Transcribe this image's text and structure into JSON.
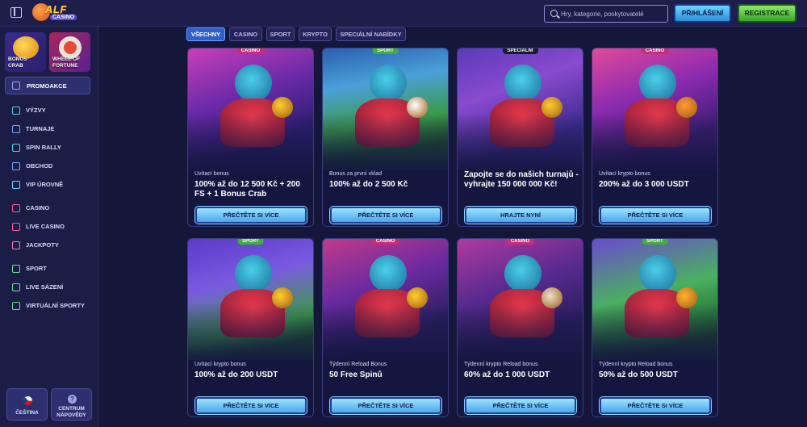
{
  "header": {
    "logo_main": "ALF",
    "logo_sub": "CASINO",
    "search_placeholder": "Hry, kategorie, poskytovatelé",
    "login_label": "PŘIHLÁŠENÍ",
    "register_label": "REGISTRACE"
  },
  "sidebar": {
    "promo_tiles": [
      {
        "label_line1": "BONUS",
        "label_line2": "CRAB"
      },
      {
        "label_line1": "WHEEL OF",
        "label_line2": "FORTUNE"
      }
    ],
    "promotions_label": "PROMOAKCE",
    "items": [
      {
        "label": "VÝZVY",
        "icon": "target-icon",
        "color": "#58d0e6"
      },
      {
        "label": "TURNAJE",
        "icon": "trophy-icon",
        "color": "#7aa8ff"
      },
      {
        "label": "SPIN RALLY",
        "icon": "rally-icon",
        "color": "#58d0e6"
      },
      {
        "label": "OBCHOD",
        "icon": "shop-icon",
        "color": "#7aa8ff"
      },
      {
        "label": "VIP ÚROVNĚ",
        "icon": "diamond-icon",
        "color": "#6ad7ff"
      },
      {
        "label": "CASINO",
        "icon": "cherry-icon",
        "color": "#ff5a9a"
      },
      {
        "label": "LIVE CASINO",
        "icon": "dealer-icon",
        "color": "#ff5a9a"
      },
      {
        "label": "JACKPOTY",
        "icon": "clover-icon",
        "color": "#ff7ab8"
      },
      {
        "label": "SPORT",
        "icon": "ball-icon",
        "color": "#6ae08a"
      },
      {
        "label": "LIVE SÁZENÍ",
        "icon": "live-icon",
        "color": "#6ae08a"
      },
      {
        "label": "VIRTUÁLNÍ SPORTY",
        "icon": "gamepad-icon",
        "color": "#6ae08a"
      }
    ],
    "language_label_1": "ČEŠTINA",
    "help_label_1": "CENTRUM",
    "help_label_2": "NÁPOVĚDY",
    "help_icon_glyph": "?"
  },
  "filters": [
    {
      "label": "VŠECHNY",
      "active": true
    },
    {
      "label": "CASINO",
      "active": false
    },
    {
      "label": "SPORT",
      "active": false
    },
    {
      "label": "KRYPTO",
      "active": false
    },
    {
      "label": "SPECIÁLNÍ NABÍDKY",
      "active": false
    }
  ],
  "cards": [
    {
      "badge": "CASINO",
      "badge_type": "casino",
      "subtitle": "Uvítací bonus",
      "title": "100% až do 12 500 Kč + 200 FS + 1 Bonus Crab",
      "cta": "PŘEČTĚTE SI VÍCE"
    },
    {
      "badge": "SPORT",
      "badge_type": "sport",
      "subtitle": "Bonus za první vklad",
      "title": "100% až do 2 500 Kč",
      "cta": "PŘEČTĚTE SI VÍCE"
    },
    {
      "badge": "SPECIÁLNÍ",
      "badge_type": "special",
      "subtitle": "",
      "title": "Zapojte se do našich turnajů - vyhrajte 150 000 000 Kč!",
      "cta": "HRAJTE NYNÍ"
    },
    {
      "badge": "CASINO",
      "badge_type": "casino",
      "subtitle": "Uvítací krypto bonus",
      "title": "200% až do 3 000 USDT",
      "cta": "PŘEČTĚTE SI VÍCE"
    },
    {
      "badge": "SPORT",
      "badge_type": "sport",
      "subtitle": "Uvítací krypto bonus",
      "title": "100% až do 200 USDT",
      "cta": "PŘEČTĚTE SI VÍCE"
    },
    {
      "badge": "CASINO",
      "badge_type": "casino",
      "subtitle": "Týdenní Reload Bonus",
      "title": "50 Free Spinů",
      "cta": "PŘEČTĚTE SI VÍCE"
    },
    {
      "badge": "CASINO",
      "badge_type": "casino",
      "subtitle": "Týdenní krypto Reload bonus",
      "title": "60% až do 1 000 USDT",
      "cta": "PŘEČTĚTE SI VÍCE"
    },
    {
      "badge": "SPORT",
      "badge_type": "sport",
      "subtitle": "Týdenní krypto Reload bonus",
      "title": "50% až do 500 USDT",
      "cta": "PŘEČTĚTE SI VÍCE"
    }
  ]
}
